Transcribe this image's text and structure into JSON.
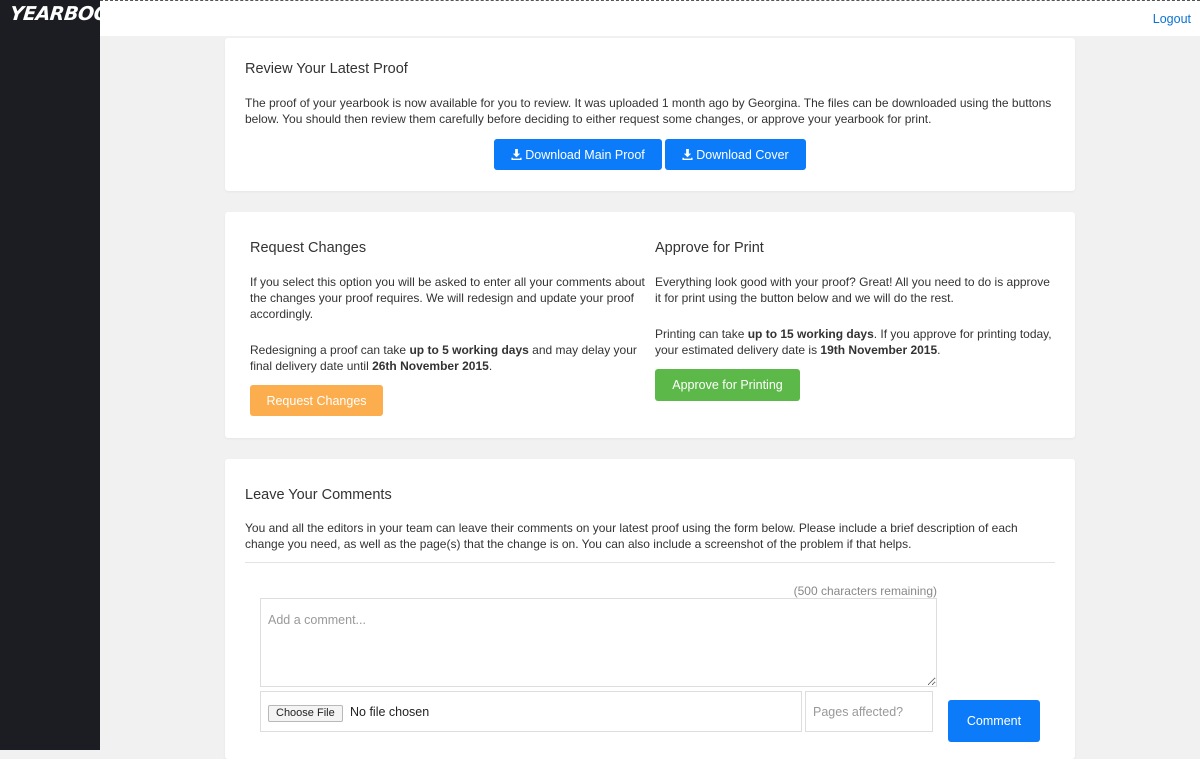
{
  "app": {
    "logo_text": "YEARBOOK",
    "logout_label": "Logout"
  },
  "review": {
    "title": "Review Your Latest Proof",
    "description": "The proof of your yearbook is now available for you to review. It was uploaded 1 month ago by Georgina. The files can be downloaded using the buttons below. You should then review them carefully before deciding to either request some changes, or approve your yearbook for print.",
    "download_main_label": "Download Main Proof",
    "download_cover_label": "Download Cover"
  },
  "request": {
    "title": "Request Changes",
    "description": "If you select this option you will be asked to enter all your comments about the changes your proof requires. We will redesign and update your proof accordingly.",
    "note_prefix": "Redesigning a proof can take ",
    "note_bold1": "up to 5 working days",
    "note_mid": " and may delay your final delivery date until ",
    "note_bold2": "26th November 2015",
    "note_suffix": ".",
    "button_label": "Request Changes"
  },
  "approve": {
    "title": "Approve for Print",
    "description": "Everything look good with your proof? Great! All you need to do is approve it for print using the button below and we will do the rest.",
    "note_prefix": "Printing can take ",
    "note_bold1": "up to 15 working days",
    "note_mid": ". If you approve for printing today, your estimated delivery date is ",
    "note_bold2": "19th November 2015",
    "note_suffix": ".",
    "button_label": "Approve for Printing"
  },
  "comments": {
    "title": "Leave Your Comments",
    "description": "You and all the editors in your team can leave their comments on your latest proof using the form below. Please include a brief description of each change you need, as well as the page(s) that the change is on. You can also include a screenshot of the problem if that helps.",
    "char_counter": "(500 characters remaining)",
    "comment_placeholder": "Add a comment...",
    "choose_file_label": "Choose File",
    "no_file_label": "No file chosen",
    "pages_placeholder": "Pages affected?",
    "submit_label": "Comment"
  },
  "colors": {
    "sidebar": "#1c1d22",
    "primary_blue": "#0b7bfa",
    "warning_orange": "#fcad4e",
    "success_green": "#5cb848",
    "link": "#0b73d6"
  }
}
